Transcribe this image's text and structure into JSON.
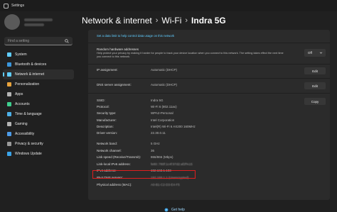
{
  "window": {
    "title": "Settings"
  },
  "sidebar": {
    "search_placeholder": "Find a setting",
    "items": [
      {
        "label": "System",
        "icon": "monitor-icon",
        "color": "#60cdff"
      },
      {
        "label": "Bluetooth & devices",
        "icon": "bluetooth-icon",
        "color": "#3a96dd"
      },
      {
        "label": "Network & internet",
        "icon": "wifi-icon",
        "color": "#60cdff",
        "selected": true
      },
      {
        "label": "Personalization",
        "icon": "brush-icon",
        "color": "#e8a33c"
      },
      {
        "label": "Apps",
        "icon": "apps-icon",
        "color": "#b4b4b4"
      },
      {
        "label": "Accounts",
        "icon": "person-icon",
        "color": "#3ecf8e"
      },
      {
        "label": "Time & language",
        "icon": "clock-globe-icon",
        "color": "#4cb0e8"
      },
      {
        "label": "Gaming",
        "icon": "gamepad-icon",
        "color": "#b4b4b4"
      },
      {
        "label": "Accessibility",
        "icon": "accessibility-icon",
        "color": "#4c9be8"
      },
      {
        "label": "Privacy & security",
        "icon": "shield-icon",
        "color": "#9a9a9a"
      },
      {
        "label": "Windows Update",
        "icon": "refresh-icon",
        "color": "#3aa3e8"
      }
    ]
  },
  "header": {
    "crumb1": "Network & internet",
    "crumb2": "Wi-Fi",
    "current": "Indra 5G",
    "separator": "›"
  },
  "content": {
    "data_limit_link": "Set a data limit to help control data usage on this network",
    "random_hw": {
      "title": "Random hardware addresses",
      "description": "Help protect your privacy by making it harder for people to track your device location when you connect to this network. The setting takes effect the next time you connect to this network.",
      "value": "Off"
    },
    "ip_assignment": {
      "label": "IP assignment:",
      "value": "Automatic (DHCP)",
      "button": "Edit"
    },
    "dns_assignment": {
      "label": "DNS server assignment:",
      "value": "Automatic (DHCP)",
      "button": "Edit"
    },
    "props": [
      {
        "label": "SSID:",
        "value": "Indra 5G"
      },
      {
        "label": "Protocol:",
        "value": "Wi-Fi 6 (802.11ax)"
      },
      {
        "label": "Security type:",
        "value": "WPA2-Personal"
      },
      {
        "label": "Manufacturer:",
        "value": "Intel Corporation"
      },
      {
        "label": "Description:",
        "value": "Intel(R) Wi-Fi 6 AX200 160MHz"
      },
      {
        "label": "Driver version:",
        "value": "22.30.0.11"
      }
    ],
    "copy_button": "Copy",
    "props2": [
      {
        "label": "Network band:",
        "value": "5 GHz"
      },
      {
        "label": "Network channel:",
        "value": "36"
      },
      {
        "label": "Link speed (Receive/Transmit):",
        "value": "866/866 (Mbps)"
      },
      {
        "label": "Link-local IPv6 address:",
        "value": "fe80::780f:1c4f:97d2:af2f%15"
      },
      {
        "label": "IPv4 address:",
        "value": "192.168.1.103"
      },
      {
        "label": "IPv4 DNS servers:",
        "value": "192.168.1.1 (Unencrypted)"
      },
      {
        "label": "Physical address (MAC):",
        "value": "A0-B1-C2-D3-E4-F5"
      }
    ],
    "highlight_color": "#e01e1e"
  },
  "footer": {
    "help_label": "Get help"
  }
}
